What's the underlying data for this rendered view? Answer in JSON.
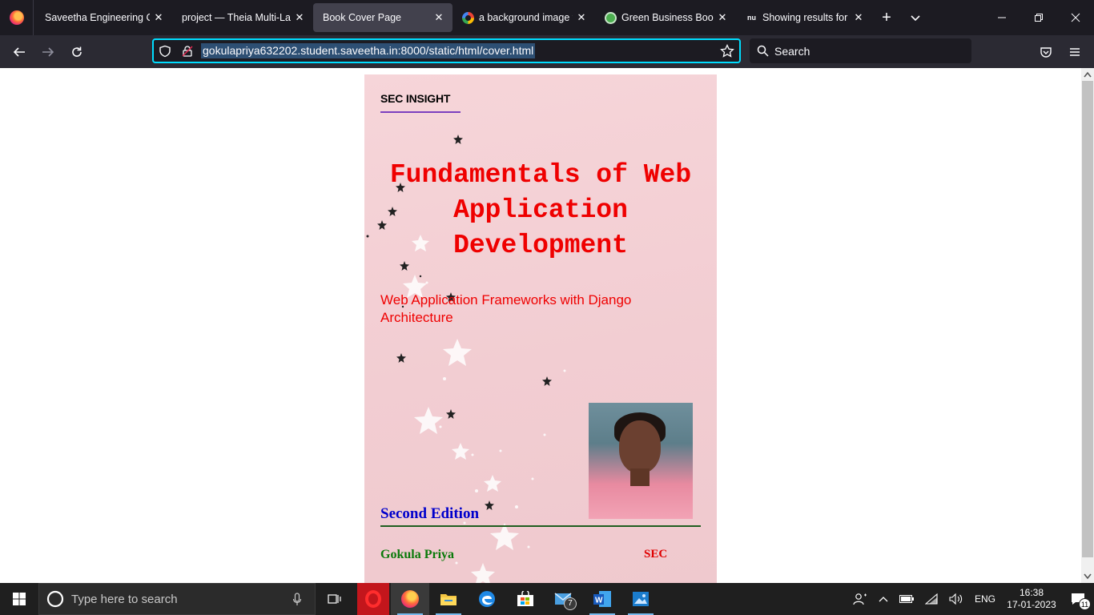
{
  "tabs": [
    {
      "title": "Saveetha Engineering College",
      "favicon": "saveetha-icon",
      "active": false
    },
    {
      "title": "project — Theia Multi-Language",
      "favicon": "theia-icon",
      "active": false
    },
    {
      "title": "Book Cover Page",
      "favicon": "none",
      "active": true
    },
    {
      "title": "a background image for",
      "favicon": "google-icon",
      "active": false
    },
    {
      "title": "Green Business Book Cover",
      "favicon": "canva-icon",
      "active": false
    },
    {
      "title": "Showing results for https",
      "favicon": "nu-icon",
      "active": false
    }
  ],
  "tab_close_glyph": "✕",
  "new_tab_glyph": "+",
  "nav": {
    "url": "gokulapriya632202.student.saveetha.in:8000/static/html/cover.html",
    "search_placeholder": "Search"
  },
  "cover": {
    "brand": "SEC INSIGHT",
    "title": "Fundamentals of Web Application Development",
    "subtitle": "Web Application Frameworks with Django Architecture",
    "edition": "Second Edition",
    "author": "Gokula Priya",
    "org": "SEC"
  },
  "taskbar": {
    "search_placeholder": "Type here to search",
    "mail_badge": "7",
    "language": "ENG",
    "time": "16:38",
    "date": "17-01-2023",
    "notification_count": "11"
  },
  "colors": {
    "title_red": "#ef0000",
    "edition_blue": "#0000cc",
    "author_green": "#0a7a0a",
    "url_focus": "#00ddff"
  }
}
